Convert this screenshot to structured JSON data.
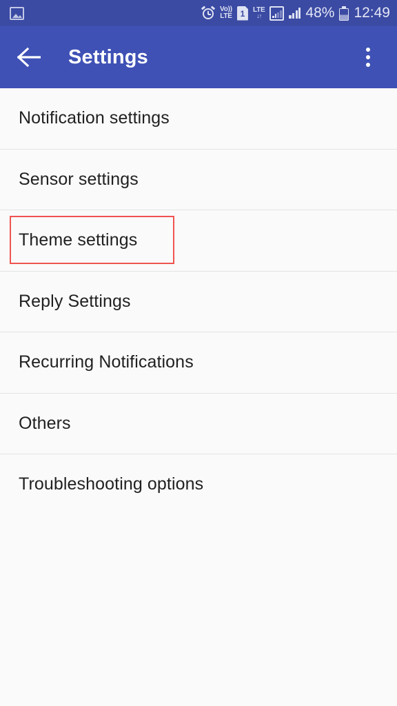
{
  "status_bar": {
    "background_color": "#3b4aa3",
    "notification_icons": [
      {
        "name": "screenshot-icon",
        "label": "Screenshot"
      }
    ],
    "system_icons": [
      {
        "name": "alarm-icon",
        "label": "Alarm set"
      },
      {
        "name": "volte-icon",
        "line1": "Vo))",
        "line2": "LTE"
      },
      {
        "name": "sim-icon",
        "label": "1"
      },
      {
        "name": "lte-data-icon",
        "line1": "LTE",
        "line2": "↓↑"
      },
      {
        "name": "signal-boxed-icon",
        "label": "Signal"
      },
      {
        "name": "signal-icon",
        "label": "Signal"
      }
    ],
    "battery_percent": "48%",
    "time": "12:49"
  },
  "app_bar": {
    "background_color": "#3f51b5",
    "back_label": "Back",
    "title": "Settings",
    "overflow_label": "More options"
  },
  "settings_list": {
    "items": [
      {
        "label": "Notification settings",
        "name": "list-item-notification-settings",
        "highlighted": false
      },
      {
        "label": "Sensor settings",
        "name": "list-item-sensor-settings",
        "highlighted": false
      },
      {
        "label": "Theme settings",
        "name": "list-item-theme-settings",
        "highlighted": true
      },
      {
        "label": "Reply Settings",
        "name": "list-item-reply-settings",
        "highlighted": false
      },
      {
        "label": "Recurring Notifications",
        "name": "list-item-recurring-notifications",
        "highlighted": false
      },
      {
        "label": "Others",
        "name": "list-item-others",
        "highlighted": false
      },
      {
        "label": "Troubleshooting options",
        "name": "list-item-troubleshooting-options",
        "highlighted": false
      }
    ]
  },
  "annotation": {
    "target": "Theme settings",
    "color": "#ef5350"
  }
}
